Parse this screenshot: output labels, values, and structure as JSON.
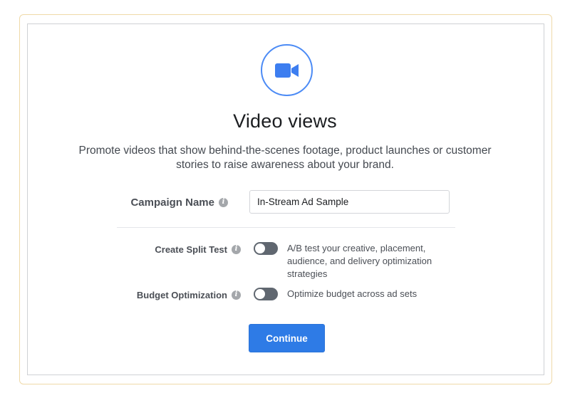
{
  "objective": {
    "icon": "video-camera-icon",
    "title": "Video views",
    "description": "Promote videos that show behind-the-scenes footage, product launches or customer stories to raise awareness about your brand."
  },
  "campaign_name": {
    "label": "Campaign Name",
    "value": "In-Stream Ad Sample"
  },
  "split_test": {
    "label": "Create Split Test",
    "enabled": false,
    "description": "A/B test your creative, placement, audience, and delivery optimization strategies"
  },
  "budget_optimization": {
    "label": "Budget Optimization",
    "enabled": false,
    "description": "Optimize budget across ad sets"
  },
  "continue_button": {
    "label": "Continue"
  },
  "colors": {
    "accent": "#2e7be6",
    "icon_blue": "#4c8bf5",
    "frame_border": "#efd9a8",
    "toggle_off": "#606770"
  }
}
